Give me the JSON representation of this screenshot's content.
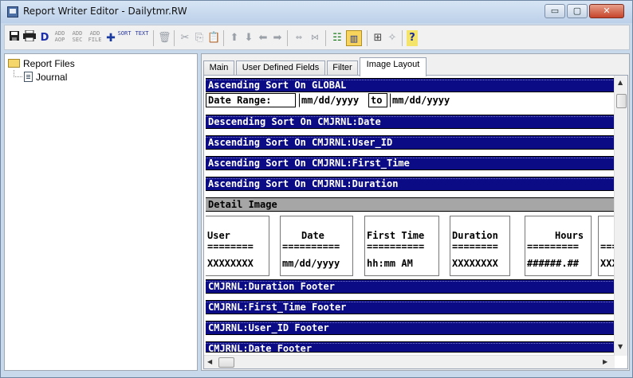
{
  "window": {
    "title": "Report Writer Editor - Dailytmr.RW",
    "minimize_label": "▭",
    "maximize_label": "▢",
    "close_label": "✕"
  },
  "toolbar": {
    "save_icon": "floppy-disk-icon",
    "print_icon": "printer-icon",
    "d_label": "D",
    "add_aop_label": "ADD AOP",
    "add_sec_label": "ADD SEC",
    "add_file_label": "ADD FILE",
    "add_sort_label": "SORT",
    "add_text_label": "TEXT",
    "help_label": "?"
  },
  "tree": {
    "root_label": "Report Files",
    "child_label": "Journal"
  },
  "tabs": [
    {
      "label": "Main"
    },
    {
      "label": "User Defined Fields"
    },
    {
      "label": "Filter"
    },
    {
      "label": "Image Layout"
    }
  ],
  "layout": {
    "sort_global": "Ascending Sort On GLOBAL",
    "date_range_label": "Date Range:",
    "date_from": "mm/dd/yyyy",
    "date_to_label": "to",
    "date_to": "mm/dd/yyyy",
    "sort_date": "Descending Sort On CMJRNL:Date",
    "sort_user": "Ascending Sort On CMJRNL:User_ID",
    "sort_first_time": "Ascending Sort On CMJRNL:First_Time",
    "sort_duration": "Ascending Sort On CMJRNL:Duration",
    "detail_image": "Detail Image",
    "columns": [
      {
        "header": "User",
        "underline": "========",
        "value": "XXXXXXXX"
      },
      {
        "header": "Date",
        "underline": "==========",
        "value": "mm/dd/yyyy"
      },
      {
        "header": "First Time",
        "underline": "==========",
        "value": "hh:mm AM"
      },
      {
        "header": "Duration",
        "underline": "========",
        "value": "XXXXXXXX"
      },
      {
        "header": "Hours",
        "underline": "=========",
        "value": "######.##"
      },
      {
        "header": "",
        "underline": "===",
        "value": "XXX"
      }
    ],
    "footer_duration": "CMJRNL:Duration Footer",
    "footer_first_time": "CMJRNL:First_Time Footer",
    "footer_user": "CMJRNL:User_ID Footer",
    "footer_date": "CMJRNL:Date Footer"
  }
}
